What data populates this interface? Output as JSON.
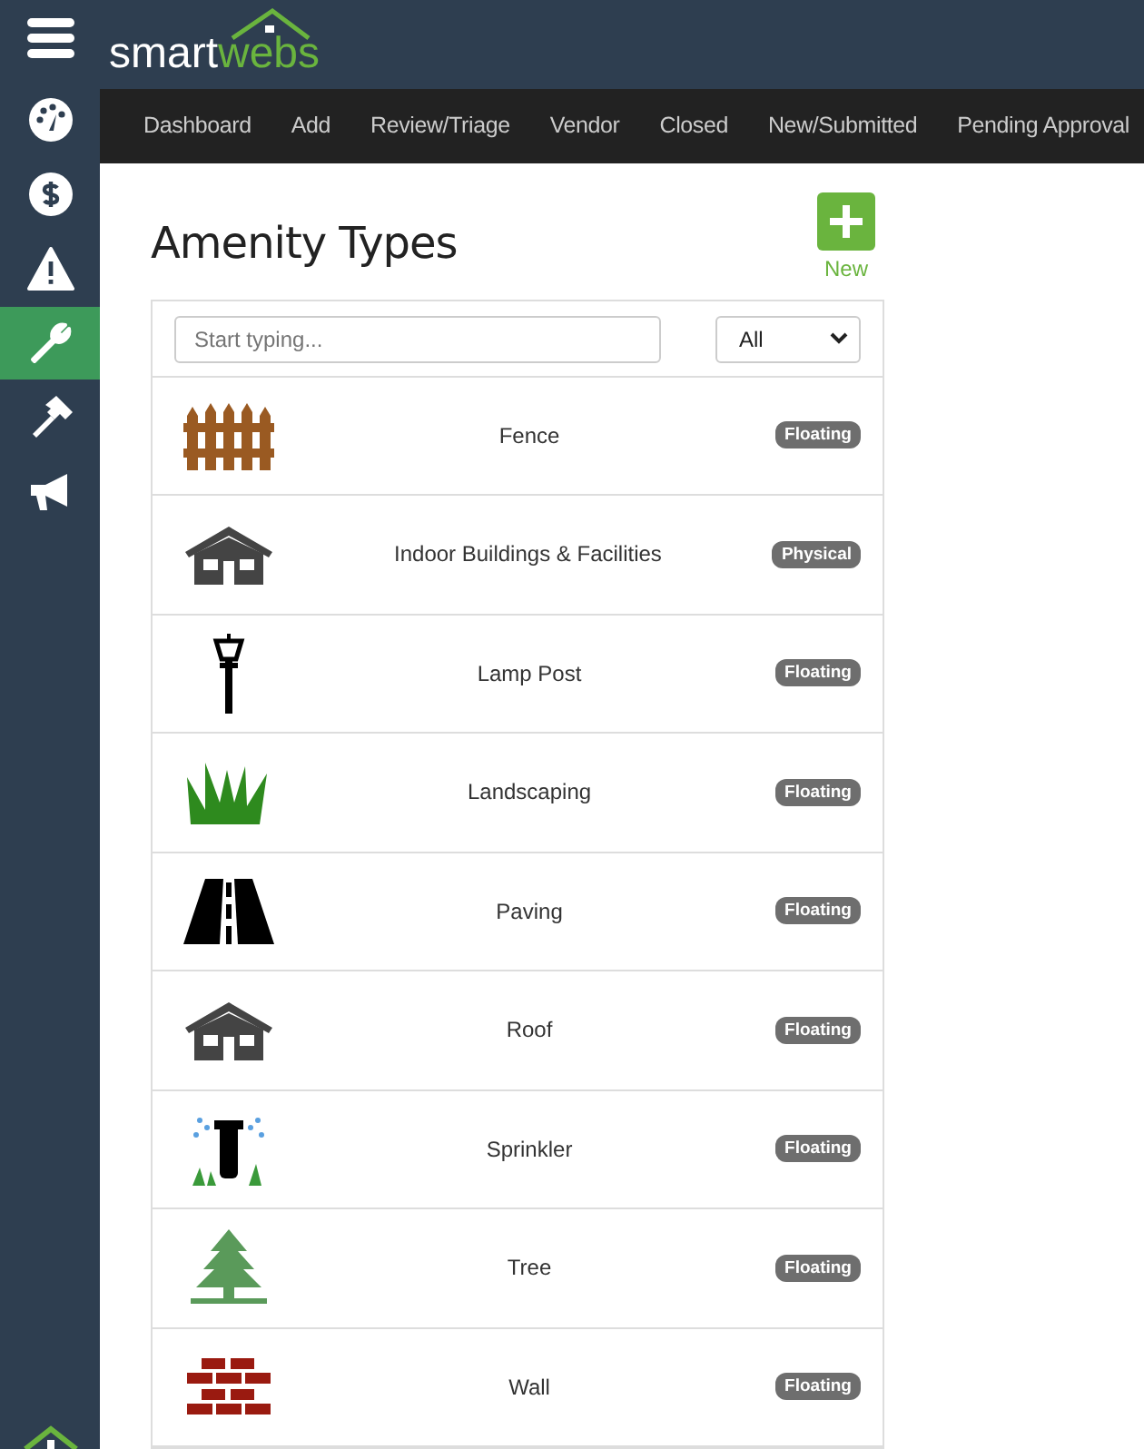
{
  "brand": [
    "smart",
    "webs"
  ],
  "sidebar": [
    {
      "kind": "dashboard",
      "selected": false
    },
    {
      "kind": "dollar",
      "selected": false
    },
    {
      "kind": "warning",
      "selected": false
    },
    {
      "kind": "wrench",
      "selected": true
    },
    {
      "kind": "hammer",
      "selected": false
    },
    {
      "kind": "megaphone",
      "selected": false
    }
  ],
  "nav": [
    "Dashboard",
    "Add",
    "Review/Triage",
    "Vendor",
    "Closed",
    "New/Submitted",
    "Pending Approval"
  ],
  "title": "Amenity Types",
  "new_button": {
    "label": "New"
  },
  "search": {
    "placeholder": "Start typing..."
  },
  "filter": {
    "value": "All"
  },
  "rows": [
    {
      "kind": "fence",
      "name": "Fence",
      "badge": "Floating"
    },
    {
      "kind": "building",
      "name": "Indoor Buildings & Facilities",
      "badge": "Physical"
    },
    {
      "kind": "lamp",
      "name": "Lamp Post",
      "badge": "Floating"
    },
    {
      "kind": "grass",
      "name": "Landscaping",
      "badge": "Floating"
    },
    {
      "kind": "road",
      "name": "Paving",
      "badge": "Floating"
    },
    {
      "kind": "building",
      "name": "Roof",
      "badge": "Floating"
    },
    {
      "kind": "sprinkler",
      "name": "Sprinkler",
      "badge": "Floating"
    },
    {
      "kind": "tree",
      "name": "Tree",
      "badge": "Floating"
    },
    {
      "kind": "brick",
      "name": "Wall",
      "badge": "Floating"
    }
  ]
}
